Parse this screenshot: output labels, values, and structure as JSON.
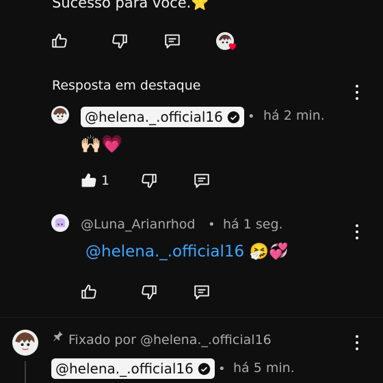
{
  "top_comment": {
    "text_tail": "Sucesso para você.⭐"
  },
  "section_label": "Resposta em destaque",
  "reply1": {
    "author": "@helena._.official16",
    "time": "há 2 min.",
    "text": "🙌🏻💗",
    "like_count": "1"
  },
  "reply2": {
    "author": "@Luna_Arianrhod",
    "time": "há 1 seg.",
    "mention": "@helena._.official16",
    "text_emoji": "🤧💞"
  },
  "pinned": {
    "label": "Fixado por @helena._.official16",
    "author": "@helena._.official16",
    "time": "há 5 min."
  },
  "colors": {
    "mention": "#3ea6ff",
    "background": "#0f0f0f",
    "heart": "#ff0033"
  }
}
